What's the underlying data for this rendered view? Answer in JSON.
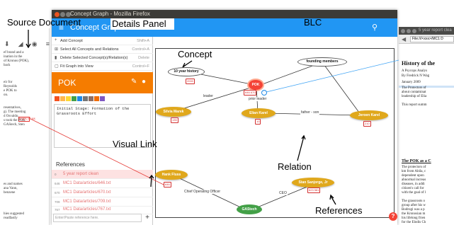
{
  "main_window": {
    "title": "Concept Graph - Mozilla Firefox",
    "app_title": "Concept Graph"
  },
  "panel": {
    "menu": [
      {
        "label": "Add Concept",
        "shortcut": "Shift+A",
        "icon": "plus-icon"
      },
      {
        "label": "Select All Concepts and Relations",
        "shortcut": "Control+A",
        "icon": "select-all-icon"
      },
      {
        "label": "Delete Selected Concept(s)/Relation(s)",
        "shortcut": "Delete",
        "icon": "trash-icon"
      },
      {
        "label": "Fit Graph into View",
        "shortcut": "Control+F",
        "icon": "fit-view-icon"
      }
    ],
    "concept_name": "POK",
    "swatch_colors": [
      "#f4511e",
      "#ffb74d",
      "#fdd835",
      "#43a047",
      "#1e88e5",
      "#757575",
      "#8d6e63",
      "#ef6c00",
      "#7e57c2"
    ],
    "description": "Initial Stage: Formation of the\nGrassroots Effort",
    "references_title": "References",
    "references": [
      {
        "num": "0",
        "label": "5 year report clean"
      },
      {
        "num": "646",
        "label": "MC1 Data/articles/646.txt"
      },
      {
        "num": "670",
        "label": "MC1 Data/articles/670.txt"
      },
      {
        "num": "709",
        "label": "MC1 Data/articles/709.txt"
      },
      {
        "num": "767",
        "label": "MC1 Data/articles/767.txt"
      }
    ],
    "reference_placeholder": "Enter/Paste reference here."
  },
  "graph": {
    "nodes": [
      {
        "id": "ten-year-history",
        "label": "10 year history",
        "style": "white"
      },
      {
        "id": "founding-members",
        "label": "founding members",
        "style": "white"
      },
      {
        "id": "pok",
        "label": "POK",
        "style": "red"
      },
      {
        "id": "silvia-marek",
        "label": "Silvia Marek",
        "style": "gold"
      },
      {
        "id": "elian-karel",
        "label": "Elian Karel",
        "style": "gold"
      },
      {
        "id": "juliana-karel",
        "label": "Jeroen Karel",
        "style": "gold"
      },
      {
        "id": "hank-fluss",
        "label": "Hank Fluss",
        "style": "gold"
      },
      {
        "id": "stan-sanjorge",
        "label": "Stan Sanjorge, Jr",
        "style": "gold"
      },
      {
        "id": "gastech",
        "label": "GAStech",
        "style": "green"
      }
    ],
    "edge_labels": [
      "leader",
      "prior leader",
      "father - son",
      "Chief Operating Officer",
      "CEO"
    ],
    "ref_badges": [
      "2000",
      "646 670",
      "135",
      "10",
      "210",
      "646",
      "623 581"
    ]
  },
  "annotations": {
    "source_document": "Source Document",
    "details_panel": "Details Panel",
    "blc": "BLC",
    "concept": "Concept",
    "visual_link": "Visual Link",
    "relation": "Relation",
    "references": "References"
  },
  "left_page": {
    "lines": [
      "ef brand and a",
      "ination in the",
      "of Kronos (POK),",
      "back",
      "",
      "",
      "",
      "eir for",
      "Reynolds",
      "e POK to",
      "on.",
      "",
      "",
      "resentatives,",
      "gi. The meeting",
      "d Osvaldo,",
      "s took the POK",
      "GAStech, Sten"
    ],
    "lines_bottom": [
      "es and names",
      "ana Vann,",
      "benzene",
      "",
      "",
      "",
      "",
      "hies suggested",
      "readfastly"
    ],
    "highlight_word": "Hank Fluss"
  },
  "right_page": {
    "window_title": "5 year report clea",
    "url": "File:///<xxx>/MC1 D",
    "heading": "History of the",
    "byline1": "A Psycops Analys",
    "byline2": "By Fredrick N Wag",
    "date": "January 2009",
    "para1": [
      "The Protectors of",
      "about contaminat",
      "leadership of Elia",
      "",
      "This report summ"
    ],
    "heading2": "The POK as a C",
    "para2": [
      "The protectors of",
      "km from Abila, c",
      "dependent upon",
      "abnormal increas",
      "diseases, in addi",
      "citizen's call for",
      "with the goal of l",
      "",
      "The grassroots o",
      "group after his w",
      "Bodrogi was a p",
      "the Kronosian m",
      "his lifelong frien",
      "for the Elodis Ch",
      "government and"
    ]
  },
  "colors": {
    "appbar": "#2196f3",
    "concept_header": "#f57c00",
    "node_gold": "#e0a81c",
    "node_green": "#43a047",
    "link_red": "#e53935"
  }
}
